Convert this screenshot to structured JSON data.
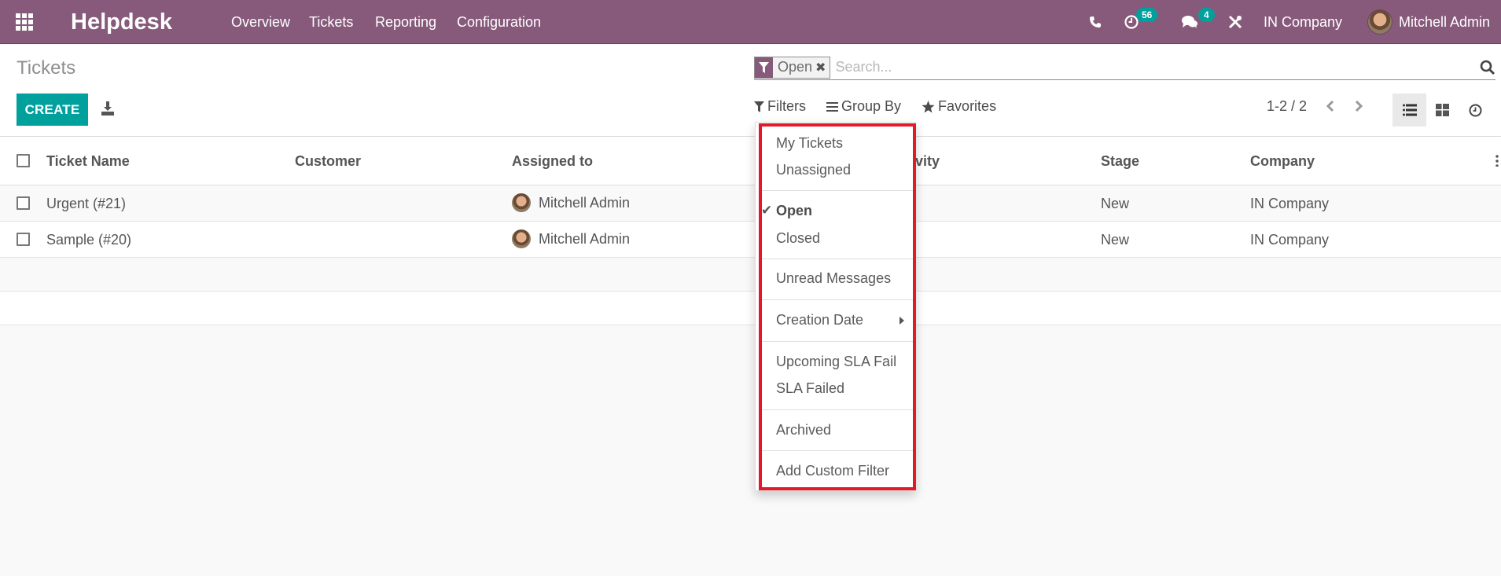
{
  "navbar": {
    "app_name": "Helpdesk",
    "menu": [
      "Overview",
      "Tickets",
      "Reporting",
      "Configuration"
    ],
    "activity_count": "56",
    "messages_count": "4",
    "company": "IN Company",
    "user": "Mitchell Admin",
    "color": "#875a7b"
  },
  "control_panel": {
    "title": "Tickets",
    "create_label": "CREATE",
    "search": {
      "facet_label": "Open",
      "placeholder": "Search..."
    },
    "filters_label": "Filters",
    "groupby_label": "Group By",
    "favorites_label": "Favorites",
    "pager": "1-2 / 2"
  },
  "table": {
    "columns": [
      "Ticket Name",
      "Customer",
      "Assigned to",
      "Activity",
      "Stage",
      "Company"
    ],
    "rows": [
      {
        "name": "Urgent (#21)",
        "customer": "",
        "assigned": "Mitchell Admin",
        "activity": "",
        "stage": "New",
        "company": "IN Company"
      },
      {
        "name": "Sample (#20)",
        "customer": "",
        "assigned": "Mitchell Admin",
        "activity": "",
        "stage": "New",
        "company": "IN Company"
      }
    ]
  },
  "filters_menu": {
    "items": [
      {
        "label": "My Tickets",
        "checked": false
      },
      {
        "label": "Unassigned",
        "checked": false
      },
      {
        "label": "Open",
        "checked": true
      },
      {
        "label": "Closed",
        "checked": false
      },
      {
        "label": "Unread Messages",
        "checked": false
      },
      {
        "label": "Creation Date",
        "checked": false,
        "submenu": true
      },
      {
        "label": "Upcoming SLA Fail",
        "checked": false
      },
      {
        "label": "SLA Failed",
        "checked": false
      },
      {
        "label": "Archived",
        "checked": false
      },
      {
        "label": "Add Custom Filter",
        "checked": false
      }
    ],
    "highlight_color": "#e3192a"
  },
  "colors": {
    "primary": "#00a09d",
    "brand": "#875a7b"
  }
}
